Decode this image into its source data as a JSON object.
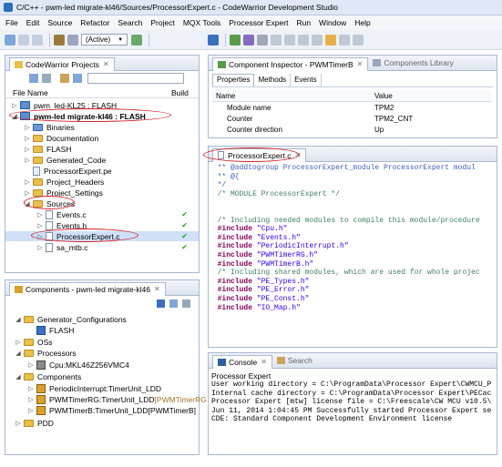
{
  "window": {
    "title": "C/C++ - pwm-led migrate-kl46/Sources/ProcessorExpert.c - CodeWarrior Development Studio"
  },
  "menu": [
    "File",
    "Edit",
    "Source",
    "Refactor",
    "Search",
    "Project",
    "MQX Tools",
    "Processor Expert",
    "Run",
    "Window",
    "Help"
  ],
  "toolbar": {
    "build_config": "(Active)"
  },
  "projects_view": {
    "tab_label": "CodeWarrior Projects",
    "col_file": "File Name",
    "col_build": "Build",
    "items": [
      {
        "label": "pwm_led-KL25 : FLASH"
      },
      {
        "label": "pwm-led migrate-kl46 : FLASH"
      },
      {
        "label": "Binaries"
      },
      {
        "label": "Documentation"
      },
      {
        "label": "FLASH"
      },
      {
        "label": "Generated_Code"
      },
      {
        "label": "ProcessorExpert.pe"
      },
      {
        "label": "Project_Headers"
      },
      {
        "label": "Project_Settings"
      },
      {
        "label": "Sources"
      },
      {
        "label": "Events.c"
      },
      {
        "label": "Events.h"
      },
      {
        "label": "ProcessorExpert.c"
      },
      {
        "label": "sa_mtb.c"
      }
    ]
  },
  "components_view": {
    "tab_label": "Components - pwm-led migrate-kl46",
    "items": [
      {
        "label": "Generator_Configurations"
      },
      {
        "label": "FLASH"
      },
      {
        "label": "OSs"
      },
      {
        "label": "Processors"
      },
      {
        "label": "Cpu:MKL46Z256VMC4"
      },
      {
        "label": "Components"
      },
      {
        "label": "PeriodicInterrupt:TimerUnit_LDD"
      },
      {
        "label": "PWMTimerRG:TimerUnit_LDD",
        "suffix": "[PWMTimerRG"
      },
      {
        "label": "PWMTimerB:TimerUnit_LDD",
        "suffix": "[PWMTimerB]"
      },
      {
        "label": "PDD"
      }
    ]
  },
  "inspector": {
    "tab_label": "Component Inspector - PWMTimerB",
    "tab2_label": "Components Library",
    "subtabs": [
      "Properties",
      "Methods",
      "Events"
    ],
    "col_name": "Name",
    "col_value": "Value",
    "rows": [
      {
        "name": "Module name",
        "value": "TPM2"
      },
      {
        "name": "Counter",
        "value": "TPM2_CNT"
      },
      {
        "name": "Counter direction",
        "value": "Up"
      }
    ]
  },
  "editor": {
    "tab_label": "ProcessorExpert.c",
    "lines": [
      {
        "text": "  ** @addtogroup ProcessorExpert_module ProcessorExpert modul",
        "cls": "doc"
      },
      {
        "text": "  ** @{",
        "cls": "doc"
      },
      {
        "text": "  */",
        "cls": "doc"
      },
      {
        "text": "  /* MODULE ProcessorExpert */",
        "cls": "cmt"
      },
      {
        "text": "",
        "cls": ""
      },
      {
        "text": "",
        "cls": ""
      },
      {
        "text": "  /* Including needed modules to compile this module/procedure",
        "cls": "cmt"
      },
      {
        "kw": "  #include ",
        "str": "\"Cpu.h\""
      },
      {
        "kw": "  #include ",
        "str": "\"Events.h\""
      },
      {
        "kw": "  #include ",
        "str": "\"PeriodicInterrupt.h\""
      },
      {
        "kw": "  #include ",
        "str": "\"PWMTimerRG.h\""
      },
      {
        "kw": "  #include ",
        "str": "\"PWMTimerB.h\""
      },
      {
        "text": "  /* Including shared modules, which are used for whole projec",
        "cls": "cmt"
      },
      {
        "kw": "  #include ",
        "str": "\"PE_Types.h\""
      },
      {
        "kw": "  #include ",
        "str": "\"PE_Error.h\""
      },
      {
        "kw": "  #include ",
        "str": "\"PE_Const.h\""
      },
      {
        "kw": "  #include ",
        "str": "\"IO_Map.h\""
      }
    ]
  },
  "console": {
    "tab_label": "Console",
    "tab2_label": "Search",
    "header": "Processor Expert",
    "lines": [
      "User working directory = C:\\ProgramData\\Processor Expert\\CWMCU_P",
      "Internal cache directory = C:\\ProgramData\\Processor Expert\\PECac",
      "Processor Expert [mtw] license file = C:\\Freescale\\CW MCU v10.5\\",
      "Jun 11, 2014 1:04:45 PM Successfully started Processor Expert se",
      "CDE: Standard Component Development Environment license"
    ]
  },
  "colors": {
    "highlight_oval": "#d21f2a",
    "selection": "#cfe0f7"
  }
}
